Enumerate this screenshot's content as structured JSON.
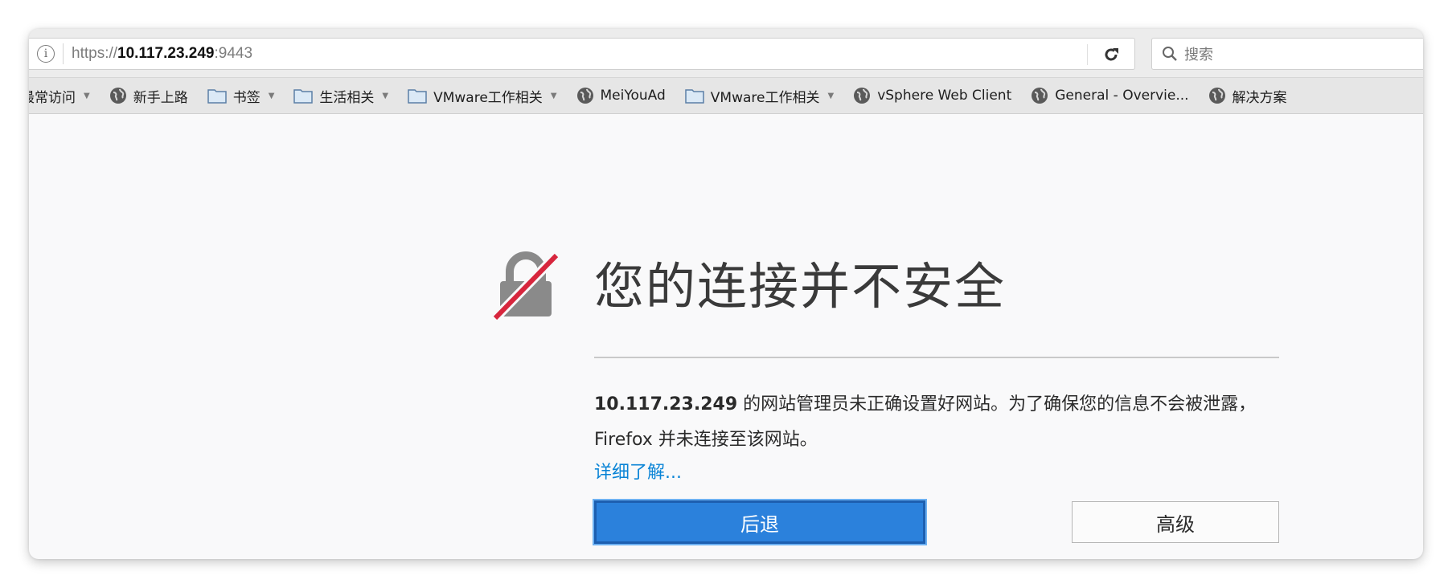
{
  "navbar": {
    "url": {
      "scheme": "https://",
      "host": "10.117.23.249",
      "port": ":9443"
    },
    "search_placeholder": "搜索"
  },
  "bookmarks": [
    {
      "label": "最常访问",
      "icon": "none",
      "dropdown": true
    },
    {
      "label": "新手上路",
      "icon": "globe-icon",
      "dropdown": false
    },
    {
      "label": "书签",
      "icon": "folder-icon",
      "dropdown": true
    },
    {
      "label": "生活相关",
      "icon": "folder-icon",
      "dropdown": true
    },
    {
      "label": "VMware工作相关",
      "icon": "folder-icon",
      "dropdown": true
    },
    {
      "label": "MeiYouAd",
      "icon": "globe-icon",
      "dropdown": false
    },
    {
      "label": "VMware工作相关",
      "icon": "folder-icon",
      "dropdown": true
    },
    {
      "label": "vSphere Web Client",
      "icon": "globe-icon",
      "dropdown": false
    },
    {
      "label": "General - Overvie...",
      "icon": "globe-icon",
      "dropdown": false
    },
    {
      "label": "解决方案",
      "icon": "globe-icon",
      "dropdown": false
    }
  ],
  "error": {
    "title": "您的连接并不安全",
    "host": "10.117.23.249",
    "message": " 的网站管理员未正确设置好网站。为了确保您的信息不会被泄露，Firefox 并未连接至该网站。",
    "learn_more": "详细了解...",
    "back_button": "后退",
    "advanced_button": "高级"
  },
  "colors": {
    "accent_blue": "#2b81dc",
    "link_blue": "#0a84d6",
    "insecure_slash": "#d7263d"
  }
}
